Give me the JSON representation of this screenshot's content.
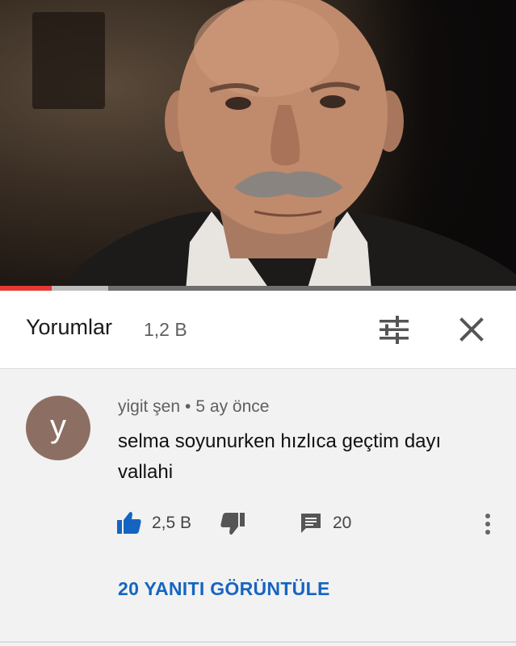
{
  "video": {
    "progress_played": 0.1,
    "progress_buffered": 0.21,
    "colors": {
      "progress": "#e53935",
      "buffer": "#bdbdbd"
    }
  },
  "comments_header": {
    "title": "Yorumlar",
    "count": "1,2 B",
    "filter_icon": "sort-filter-icon",
    "close_icon": "close-icon"
  },
  "comment": {
    "avatar_letter": "y",
    "avatar_color": "#8d6e63",
    "author": "yigit şen",
    "separator": "•",
    "time": "5 ay önce",
    "text": "selma soyunurken hızlıca geçtim dayı vallahi",
    "likes": "2,5 B",
    "reply_count": "20",
    "icons": [
      "thumb-up-icon",
      "thumb-down-icon",
      "comment-icon",
      "more-vert-icon"
    ]
  },
  "view_replies_label": "20 YANITI GÖRÜNTÜLE",
  "accent_color": "#1565c0"
}
